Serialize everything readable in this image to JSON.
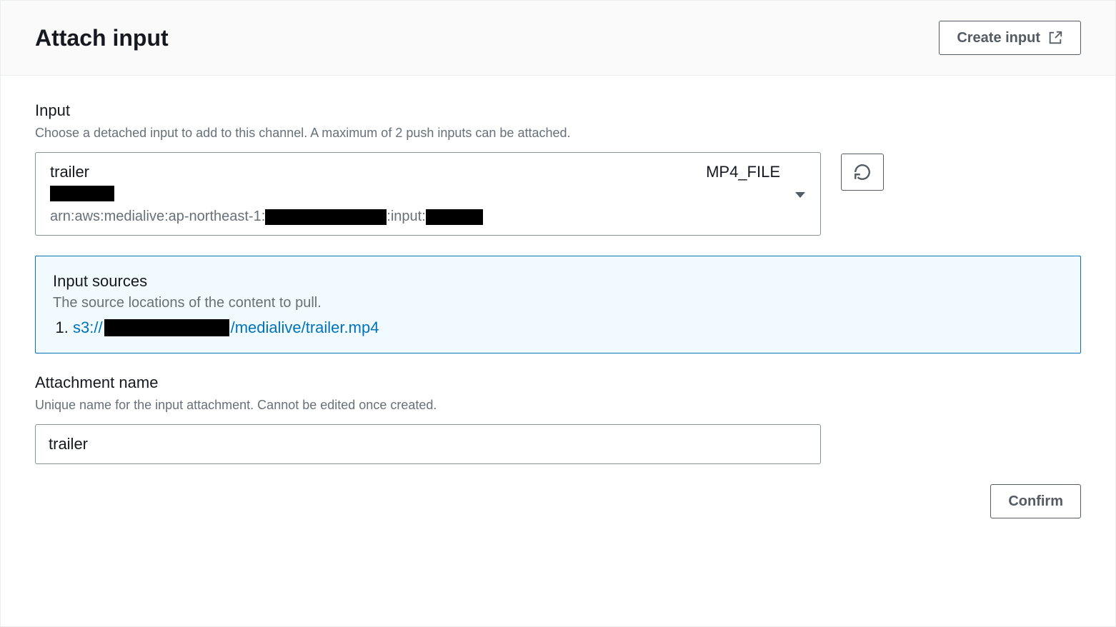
{
  "header": {
    "title": "Attach input",
    "create_input_label": "Create input"
  },
  "input_section": {
    "label": "Input",
    "help": "Choose a detached input to add to this channel. A maximum of 2 push inputs can be attached.",
    "selected": {
      "name": "trailer",
      "type": "MP4_FILE",
      "arn_prefix": "arn:aws:medialive:ap-northeast-1:",
      "arn_mid": ":input:"
    }
  },
  "input_sources": {
    "title": "Input sources",
    "help": "The source locations of the content to pull.",
    "source1_prefix": "s3://",
    "source1_suffix": "/medialive/trailer.mp4"
  },
  "attachment": {
    "label": "Attachment name",
    "help": "Unique name for the input attachment. Cannot be edited once created.",
    "value": "trailer"
  },
  "footer": {
    "confirm_label": "Confirm"
  }
}
